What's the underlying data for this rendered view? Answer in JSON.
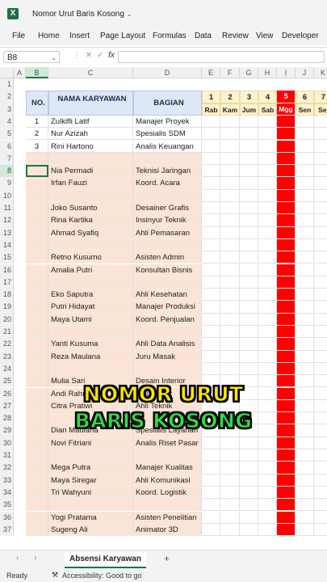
{
  "window": {
    "title": "Nomor Urut Baris Kosong"
  },
  "ribbon_tabs": [
    "File",
    "Home",
    "Insert",
    "Page Layout",
    "Formulas",
    "Data",
    "Review",
    "View",
    "Developer"
  ],
  "formula_bar": {
    "name_box": "B8",
    "fx": "fx",
    "formula": ""
  },
  "columns": [
    "A",
    "B",
    "C",
    "D",
    "E",
    "F",
    "G",
    "H",
    "I",
    "J",
    "K"
  ],
  "rows": [
    "1",
    "2",
    "3",
    "4",
    "5",
    "6",
    "7",
    "8",
    "9",
    "10",
    "11",
    "12",
    "13",
    "14",
    "15",
    "16",
    "17",
    "18",
    "19",
    "20",
    "21",
    "22",
    "23",
    "24",
    "25",
    "26",
    "27",
    "28",
    "29",
    "30",
    "31",
    "32",
    "33",
    "34",
    "35",
    "36",
    "37"
  ],
  "table_headers": {
    "no": "NO.",
    "nama": "NAMA KARYAWAN",
    "bagian": "BAGIAN"
  },
  "days": [
    {
      "num": "1",
      "day": "Rab"
    },
    {
      "num": "2",
      "day": "Kam"
    },
    {
      "num": "3",
      "day": "Jum"
    },
    {
      "num": "4",
      "day": "Sab"
    },
    {
      "num": "5",
      "day": "Mgg"
    },
    {
      "num": "6",
      "day": "Sen"
    },
    {
      "num": "7",
      "day": "Sel"
    }
  ],
  "employees": [
    {
      "no": "1",
      "nama": "Zulkifli Latif",
      "bagian": "Manajer Proyek"
    },
    {
      "no": "2",
      "nama": "Nur Azizah",
      "bagian": "Spesialis SDM"
    },
    {
      "no": "3",
      "nama": "Rini Hartono",
      "bagian": "Analis Keuangan"
    },
    {
      "no": "",
      "nama": "",
      "bagian": ""
    },
    {
      "no": "",
      "nama": "Nia Permadi",
      "bagian": "Teknisi Jaringan"
    },
    {
      "no": "",
      "nama": "Irfan Fauzi",
      "bagian": "Koord. Acara"
    },
    {
      "no": "",
      "nama": "",
      "bagian": ""
    },
    {
      "no": "",
      "nama": "Joko Susanto",
      "bagian": "Desainer Grafis"
    },
    {
      "no": "",
      "nama": "Rina Kartika",
      "bagian": "Insinyur Teknik"
    },
    {
      "no": "",
      "nama": "Ahmad Syafiq",
      "bagian": "Ahli Pemasaran"
    },
    {
      "no": "",
      "nama": "",
      "bagian": ""
    },
    {
      "no": "",
      "nama": "Retno Kusumo",
      "bagian": "Asisten Admin"
    },
    {
      "no": "",
      "nama": "Amalia Putri",
      "bagian": "Konsultan Bisnis"
    },
    {
      "no": "",
      "nama": "",
      "bagian": ""
    },
    {
      "no": "",
      "nama": "Eko Saputra",
      "bagian": "Ahli Kesehatan"
    },
    {
      "no": "",
      "nama": "Putri Hidayat",
      "bagian": "Manajer Produksi"
    },
    {
      "no": "",
      "nama": "Maya Utami",
      "bagian": "Koord. Penjualan"
    },
    {
      "no": "",
      "nama": "",
      "bagian": ""
    },
    {
      "no": "",
      "nama": "Yanti Kusuma",
      "bagian": "Ahli Data Analisis"
    },
    {
      "no": "",
      "nama": "Reza Maulana",
      "bagian": "Juru Masak"
    },
    {
      "no": "",
      "nama": "",
      "bagian": ""
    },
    {
      "no": "",
      "nama": "Mulia Sari",
      "bagian": "Desain Interior"
    },
    {
      "no": "",
      "nama": "Andi Rahman",
      "bagian": "Ahli Teknik"
    },
    {
      "no": "",
      "nama": "Citra Pratiwi",
      "bagian": "Ahli Teknik"
    },
    {
      "no": "",
      "nama": "",
      "bagian": ""
    },
    {
      "no": "",
      "nama": "Dian Maulana",
      "bagian": "Spesialis Layanan"
    },
    {
      "no": "",
      "nama": "Novi Fitriani",
      "bagian": "Analis Riset Pasar"
    },
    {
      "no": "",
      "nama": "",
      "bagian": ""
    },
    {
      "no": "",
      "nama": "Mega Putra",
      "bagian": "Manajer Kualitas"
    },
    {
      "no": "",
      "nama": "Maya Siregar",
      "bagian": "Ahli Komunikasi"
    },
    {
      "no": "",
      "nama": "Tri Wahyuni",
      "bagian": "Koord. Logistik"
    },
    {
      "no": "",
      "nama": "",
      "bagian": ""
    },
    {
      "no": "",
      "nama": "Yogi Pratama",
      "bagian": "Asisten Penelitian"
    },
    {
      "no": "",
      "nama": "Sugeng Ali",
      "bagian": "Animator 3D"
    }
  ],
  "overlay": {
    "line1": "NOMOR URUT",
    "line2": "BARIS KOSONG"
  },
  "sheet_tab": "Absensi Karyawan",
  "status": {
    "ready": "Ready",
    "accessibility": "Accessibility: Good to go"
  },
  "colors": {
    "excel_green": "#217346",
    "weekend_red": "#ff0000",
    "header_blue": "#dde7f6",
    "day_yellow": "#fff2cc",
    "row_peach": "#fbe4d5"
  }
}
